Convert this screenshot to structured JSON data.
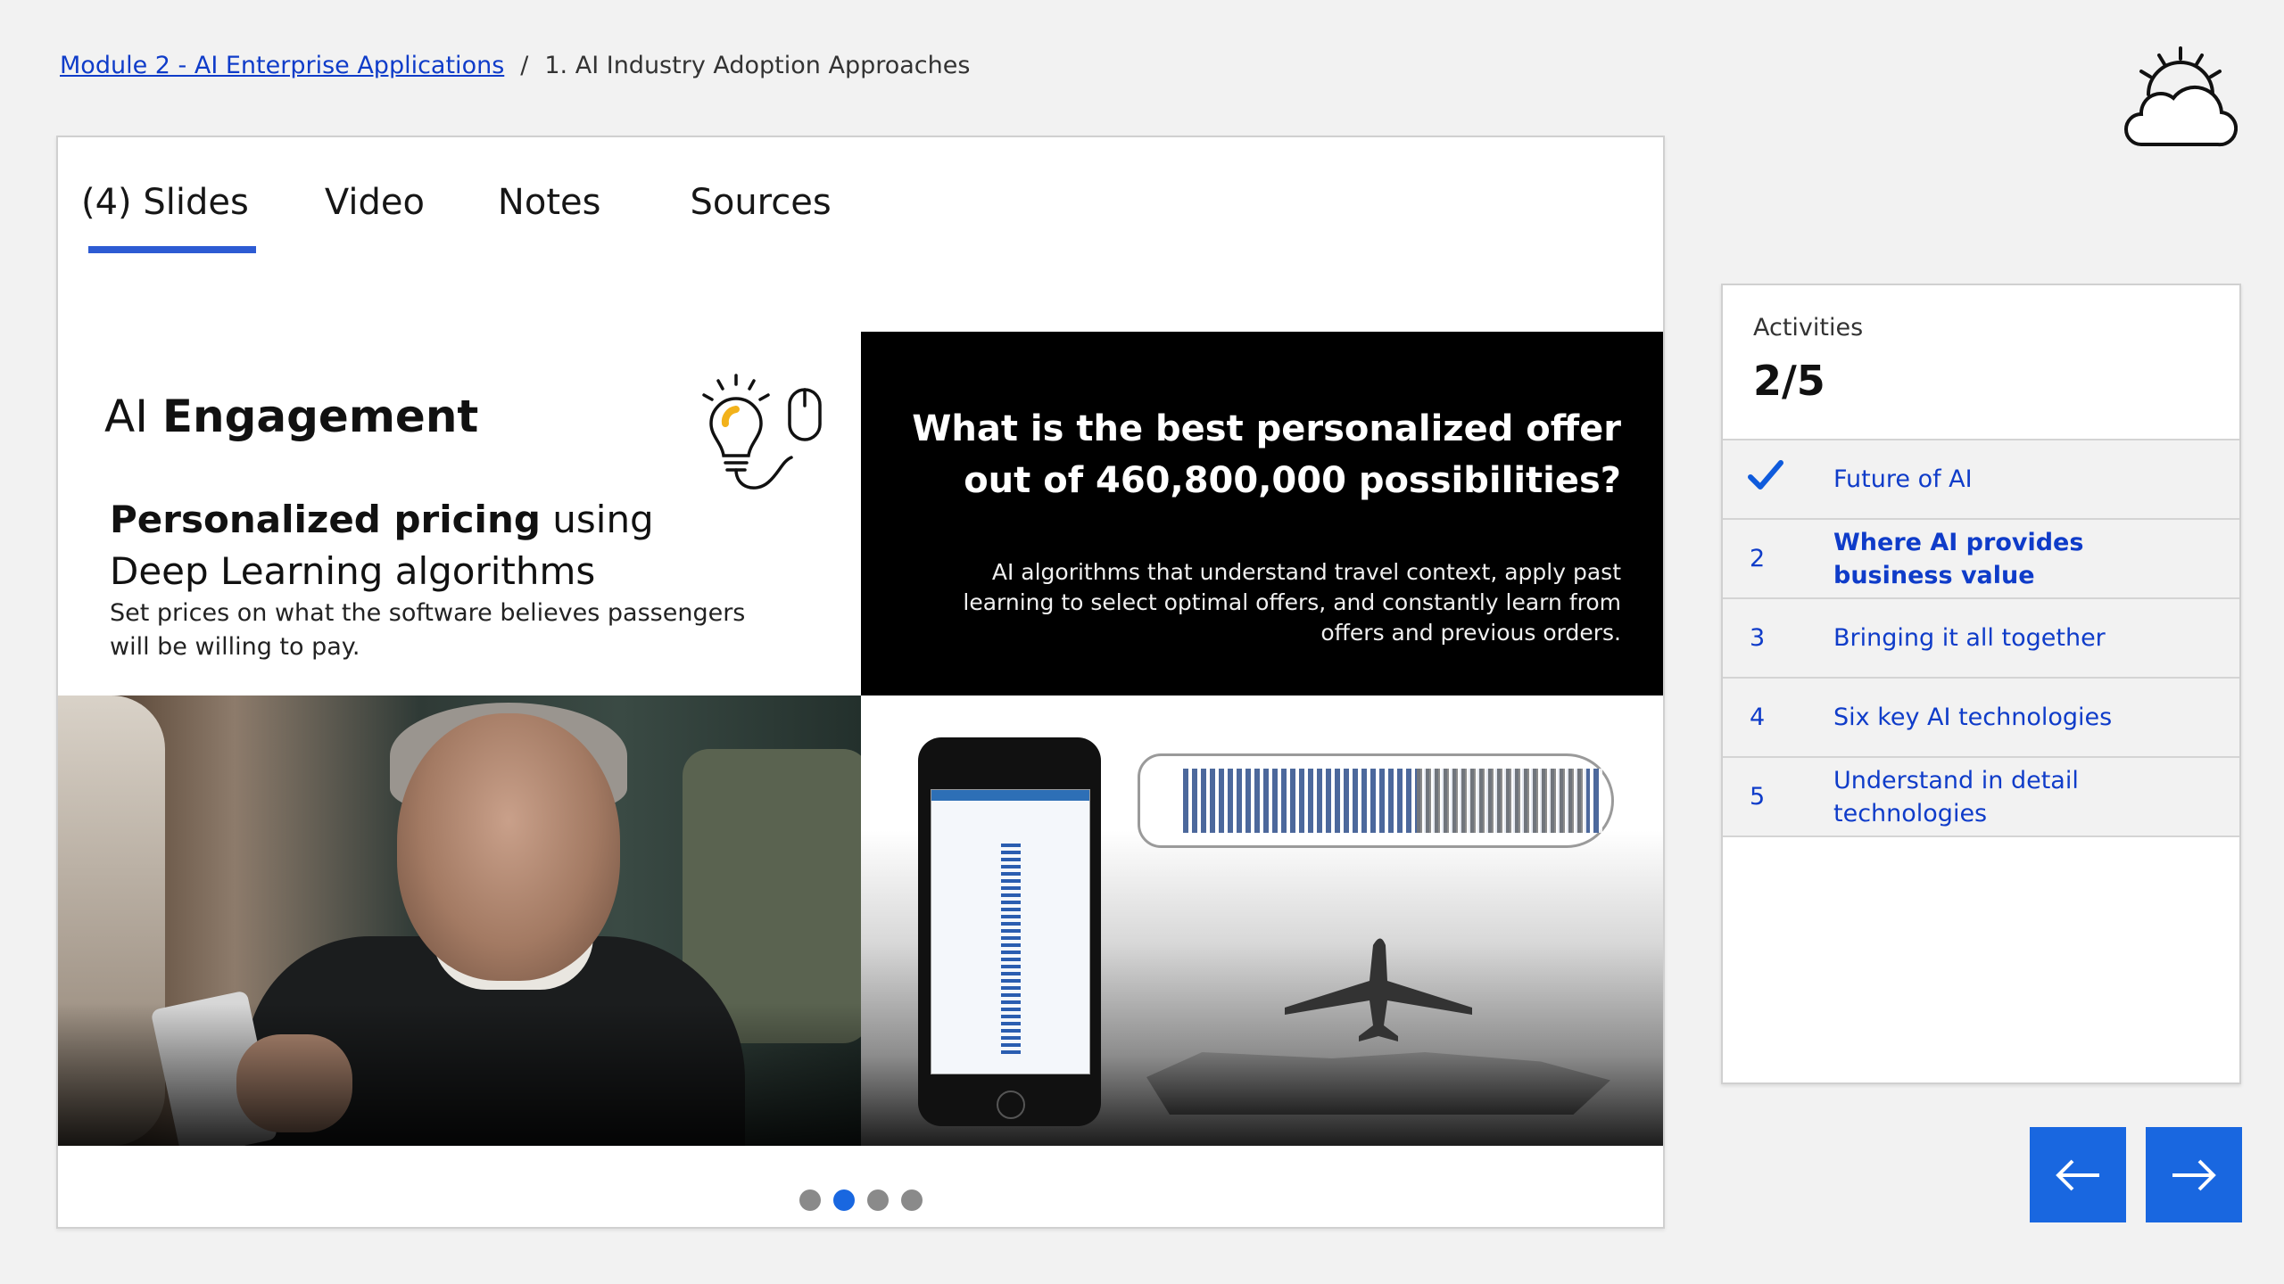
{
  "breadcrumb": {
    "parent": "Module 2 - AI Enterprise Applications",
    "separator": "/",
    "current": "1. AI Industry Adoption Approaches"
  },
  "logo": {
    "icon": "cloud-sun-icon"
  },
  "tabs": [
    {
      "label": "(4) Slides",
      "active": true
    },
    {
      "label": "Video",
      "active": false
    },
    {
      "label": "Notes",
      "active": false
    },
    {
      "label": "Sources",
      "active": false
    }
  ],
  "slide": {
    "title_prefix": "AI ",
    "title_bold": "Engagement",
    "heading_bold": "Personalized pricing",
    "heading_rest": " using Deep Learning algorithms",
    "body": "Set prices on what the software believes passengers will be willing to pay.",
    "question": "What is the best personalized offer out of 460,800,000 possibilities?",
    "description": "AI algorithms that understand travel context, apply past learning to select optimal offers, and constantly learn from offers and previous orders."
  },
  "pagination": {
    "total": 4,
    "current": 2
  },
  "activities": {
    "label": "Activities",
    "count": "2/5",
    "items": [
      {
        "number": "✓",
        "label": "Future of AI",
        "completed": true,
        "current": false
      },
      {
        "number": "2",
        "label": "Where AI provides business value",
        "completed": false,
        "current": true
      },
      {
        "number": "3",
        "label": "Bringing it all together",
        "completed": false,
        "current": false
      },
      {
        "number": "4",
        "label": "Six key AI technologies",
        "completed": false,
        "current": false
      },
      {
        "number": "5",
        "label": "Understand in detail technologies",
        "completed": false,
        "current": false
      }
    ]
  },
  "navigation": {
    "prev_icon": "arrow-left-icon",
    "next_icon": "arrow-right-icon"
  },
  "colors": {
    "accent": "#1967e0",
    "link": "#0f3cc9",
    "tab_underline": "#2d5bd3"
  }
}
